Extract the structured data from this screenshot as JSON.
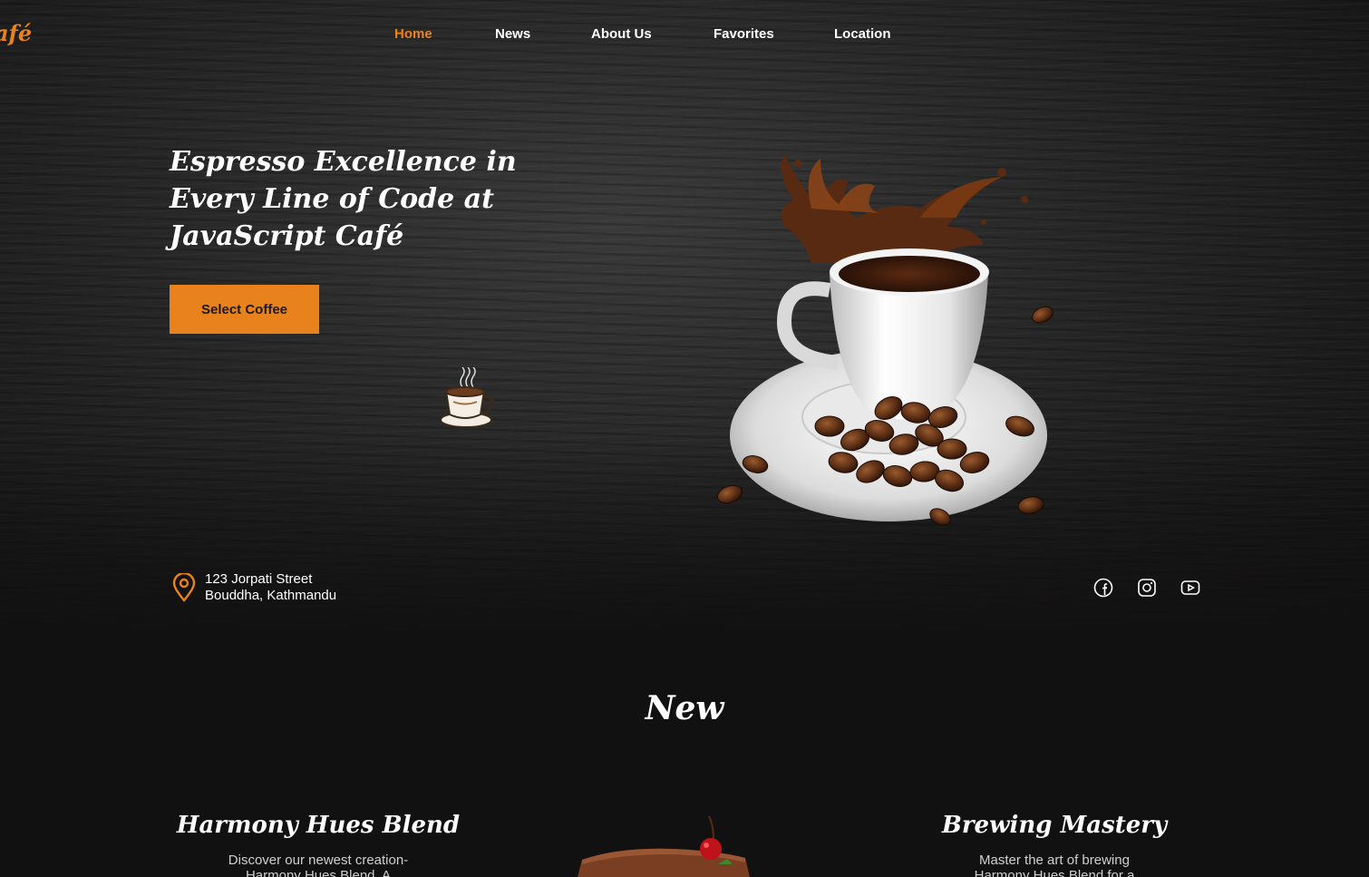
{
  "brand": {
    "logo_text": "afé",
    "accent_color": "#e8821c"
  },
  "nav": {
    "items": [
      {
        "label": "Home",
        "active": true
      },
      {
        "label": "News",
        "active": false
      },
      {
        "label": "About Us",
        "active": false
      },
      {
        "label": "Favorites",
        "active": false
      },
      {
        "label": "Location",
        "active": false
      }
    ]
  },
  "hero": {
    "title": "Espresso Excellence in Every Line of Code at JavaScript Café",
    "cta_label": "Select Coffee"
  },
  "contact": {
    "address_line1": "123 Jorpati Street",
    "address_line2": "Bouddha, Kathmandu",
    "pin_icon": "location-pin-icon"
  },
  "social": {
    "icons": [
      "facebook-icon",
      "instagram-icon",
      "youtube-icon"
    ]
  },
  "new_section": {
    "title": "New",
    "cards": [
      {
        "title": "Harmony Hues Blend",
        "desc_line1": "Discover our newest creation-",
        "desc_line2": "Harmony Hues Blend. A"
      },
      {
        "title": "Brewing Mastery",
        "desc_line1": "Master the art of brewing",
        "desc_line2": "Harmony Hues Blend for a"
      }
    ]
  }
}
